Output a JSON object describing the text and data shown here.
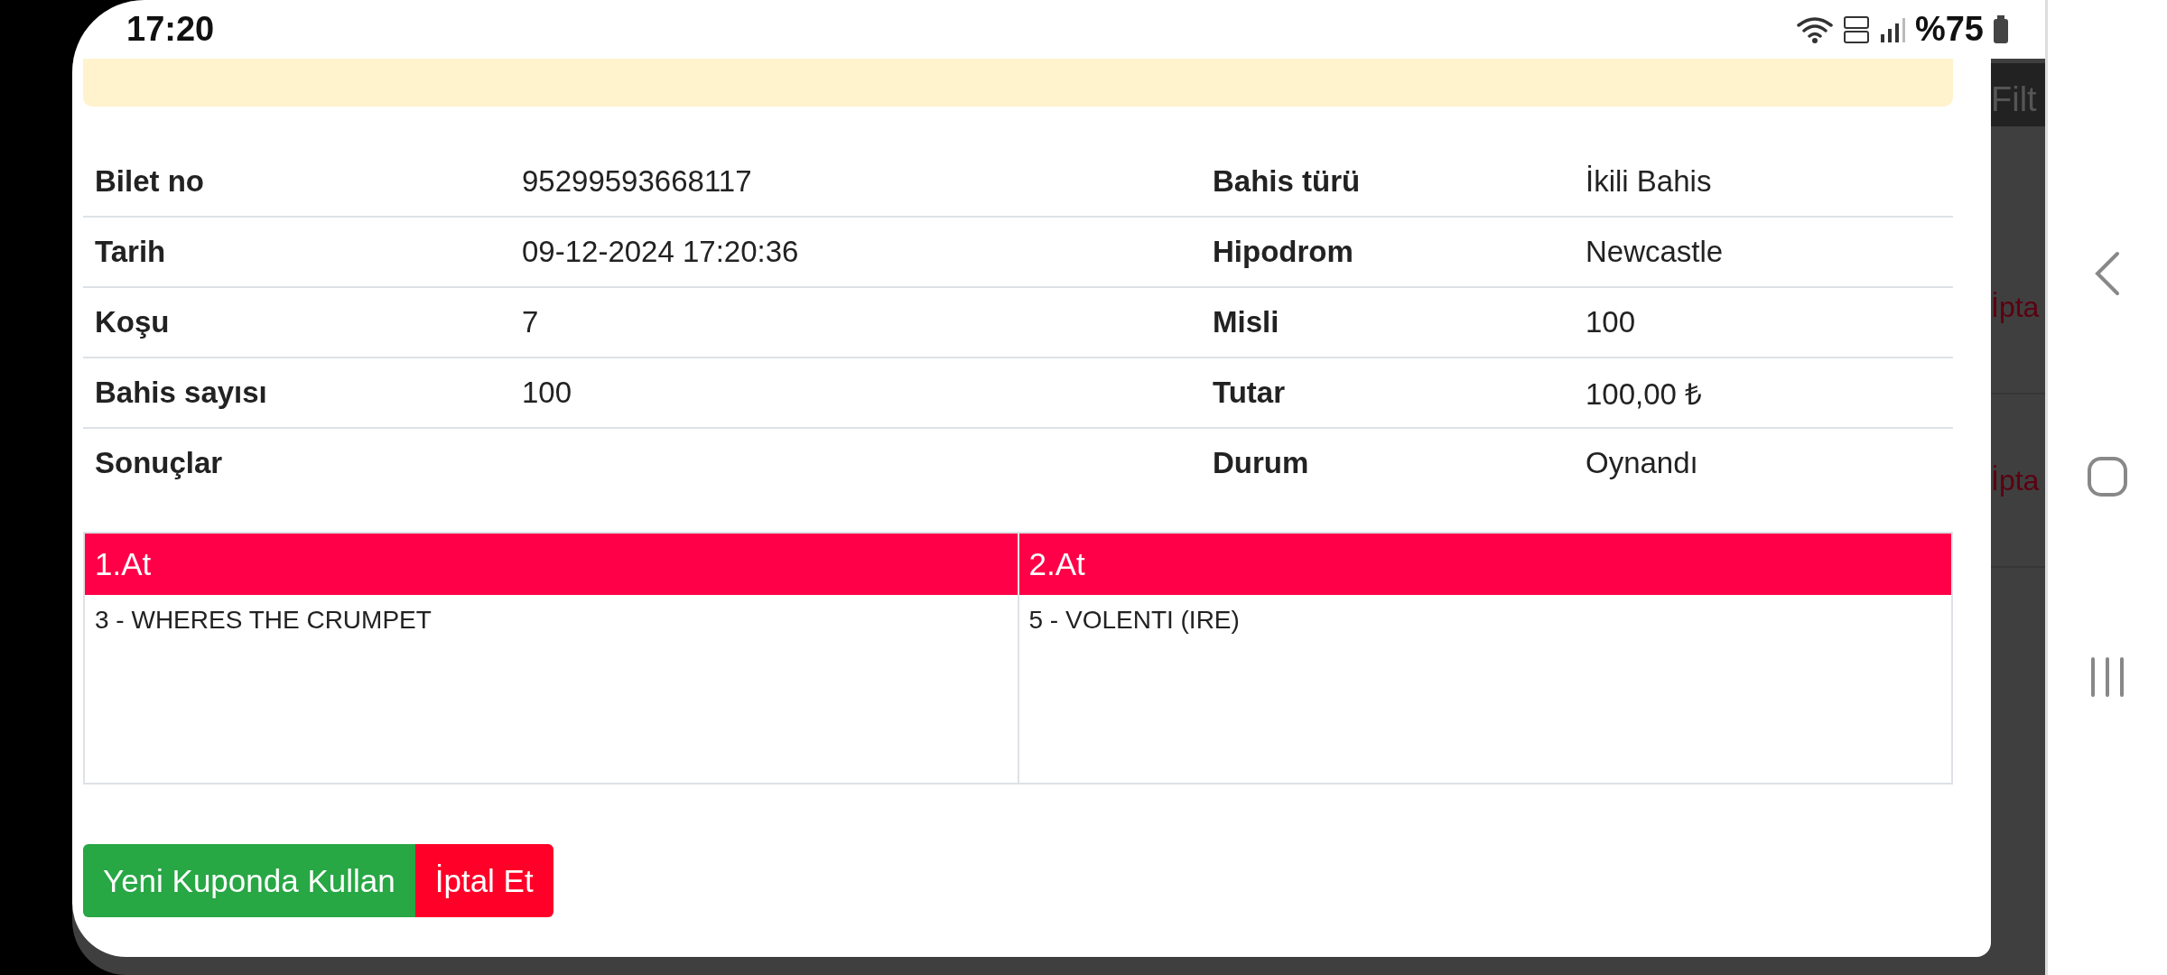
{
  "status_bar": {
    "time": "17:20",
    "battery": "%75"
  },
  "details": [
    {
      "label": "Bilet no",
      "value": "95299593668117",
      "label2": "Bahis türü",
      "value2": "İkili Bahis"
    },
    {
      "label": "Tarih",
      "value": "09-12-2024 17:20:36",
      "label2": "Hipodrom",
      "value2": "Newcastle"
    },
    {
      "label": "Koşu",
      "value": "7",
      "label2": "Misli",
      "value2": "100"
    },
    {
      "label": "Bahis sayısı",
      "value": "100",
      "label2": "Tutar",
      "value2": "100,00 ₺"
    },
    {
      "label": "Sonuçlar",
      "label2": "Durum",
      "value2": "Oynandı"
    }
  ],
  "horses": [
    {
      "header": "1.At",
      "entries": [
        "3 - WHERES THE CRUMPET"
      ]
    },
    {
      "header": "2.At",
      "entries": [
        "5 - VOLENTI (IRE)"
      ]
    }
  ],
  "buttons": [
    {
      "label": "Yeni Kuponda Kullan",
      "kind": "primary"
    },
    {
      "label": "İptal Et",
      "kind": "danger"
    }
  ],
  "background": {
    "filter_button": "Filt",
    "row_actions": [
      "İpta",
      "İpta"
    ]
  }
}
